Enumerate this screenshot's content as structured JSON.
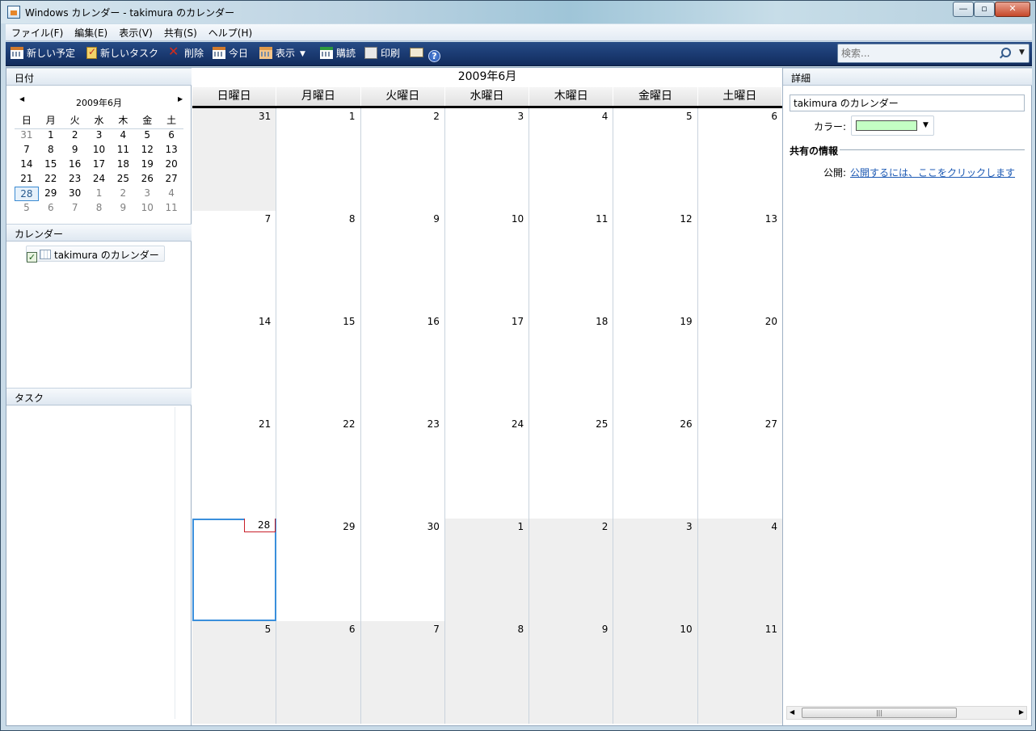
{
  "window": {
    "title": "Windows カレンダー - takimura のカレンダー"
  },
  "menu": [
    "ファイル(F)",
    "編集(E)",
    "表示(V)",
    "共有(S)",
    "ヘルプ(H)"
  ],
  "toolbar": {
    "new_event": "新しい予定",
    "new_task": "新しいタスク",
    "delete": "削除",
    "today": "今日",
    "view": "表示",
    "subscribe": "購読",
    "print": "印刷",
    "search_placeholder": "検索..."
  },
  "left": {
    "date_header": "日付",
    "mini_title": "2009年6月",
    "weekdays": [
      "日",
      "月",
      "火",
      "水",
      "木",
      "金",
      "土"
    ],
    "mini_weeks": [
      [
        "31",
        "1",
        "2",
        "3",
        "4",
        "5",
        "6"
      ],
      [
        "7",
        "8",
        "9",
        "10",
        "11",
        "12",
        "13"
      ],
      [
        "14",
        "15",
        "16",
        "17",
        "18",
        "19",
        "20"
      ],
      [
        "21",
        "22",
        "23",
        "24",
        "25",
        "26",
        "27"
      ],
      [
        "28",
        "29",
        "30",
        "1",
        "2",
        "3",
        "4"
      ],
      [
        "5",
        "6",
        "7",
        "8",
        "9",
        "10",
        "11"
      ]
    ],
    "calendars_header": "カレンダー",
    "calendar_name": "takimura のカレンダー",
    "tasks_header": "タスク"
  },
  "main": {
    "month_title": "2009年6月",
    "weekdays": [
      "日曜日",
      "月曜日",
      "火曜日",
      "水曜日",
      "木曜日",
      "金曜日",
      "土曜日"
    ],
    "weeks": [
      [
        "31",
        "1",
        "2",
        "3",
        "4",
        "5",
        "6"
      ],
      [
        "7",
        "8",
        "9",
        "10",
        "11",
        "12",
        "13"
      ],
      [
        "14",
        "15",
        "16",
        "17",
        "18",
        "19",
        "20"
      ],
      [
        "21",
        "22",
        "23",
        "24",
        "25",
        "26",
        "27"
      ],
      [
        "28",
        "29",
        "30",
        "1",
        "2",
        "3",
        "4"
      ],
      [
        "5",
        "6",
        "7",
        "8",
        "9",
        "10",
        "11"
      ]
    ]
  },
  "details": {
    "header": "詳細",
    "calendar_name": "takimura のカレンダー",
    "color_label": "カラー:",
    "calendar_color": "#c4ffc4",
    "sharing_header": "共有の情報",
    "publish_label": "公開:",
    "publish_link": "公開するには、ここをクリックします"
  },
  "colors": {
    "accent": "#3a8fdc",
    "today_marker": "#c8202a",
    "toolbar": "#1b3b73"
  }
}
